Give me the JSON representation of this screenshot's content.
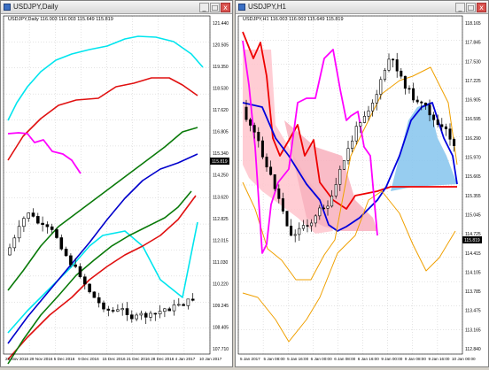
{
  "windows": {
    "left": {
      "title": "USDJPY,Daily",
      "legend": "USDJPY,Daily  116.003 116.003 115.649 115.819",
      "price_tag": "115.819",
      "y_ticks": [
        "121.440",
        "120.505",
        "119.350",
        "118.530",
        "117.620",
        "116.805",
        "115.340",
        "114.250",
        "113.620",
        "112.825",
        "112.015",
        "111.030",
        "110.220",
        "109.245",
        "108.405",
        "107.710"
      ],
      "x_ticks": [
        "23 Nov 2016",
        "29 Nov 2016",
        "5 Dec 2016",
        "9 Dec 2016",
        "15 Dec 2016",
        "21 Dec 2016",
        "28 Dec 2016",
        "4 Jan 2017",
        "10 Jan 2017"
      ]
    },
    "right": {
      "title": "USDJPY,H1",
      "legend": "USDJPY,H1  116.003 116.003 115.649 115.819",
      "price_tag": "115.819",
      "y_ticks": [
        "118.165",
        "117.845",
        "117.530",
        "117.225",
        "116.905",
        "116.595",
        "116.290",
        "115.970",
        "115.665",
        "115.355",
        "115.045",
        "114.725",
        "114.415",
        "114.105",
        "113.785",
        "113.475",
        "113.165",
        "112.840"
      ],
      "x_ticks": [
        "5 Jan 2017",
        "5 Jan 08:00",
        "5 Jan 16:00",
        "6 Jan 00:00",
        "6 Jan 08:00",
        "6 Jan 16:00",
        "9 Jan 00:00",
        "9 Jan 08:00",
        "9 Jan 16:00",
        "10 Jan 00:00"
      ]
    }
  },
  "buttons": {
    "minimize": "_",
    "maximize": "□",
    "close": "x"
  },
  "colors": {
    "bull": "#ffffff",
    "bear": "#000000",
    "bb_outer": "#00e5ee",
    "bb_mid": "#e01010",
    "bb_inner": "#0a7a0a",
    "ma": "#0000cc",
    "chikou": "#ff00ff",
    "kumo_bear": "#ffb6c1",
    "kumo_bull": "#87c4ec",
    "senkou_a": "#0000dd",
    "senkou_b": "#ee0000",
    "bb_h1": "#f0a000",
    "price_tag": "#000000"
  },
  "icons": {
    "window": "chart-window-icon"
  }
}
